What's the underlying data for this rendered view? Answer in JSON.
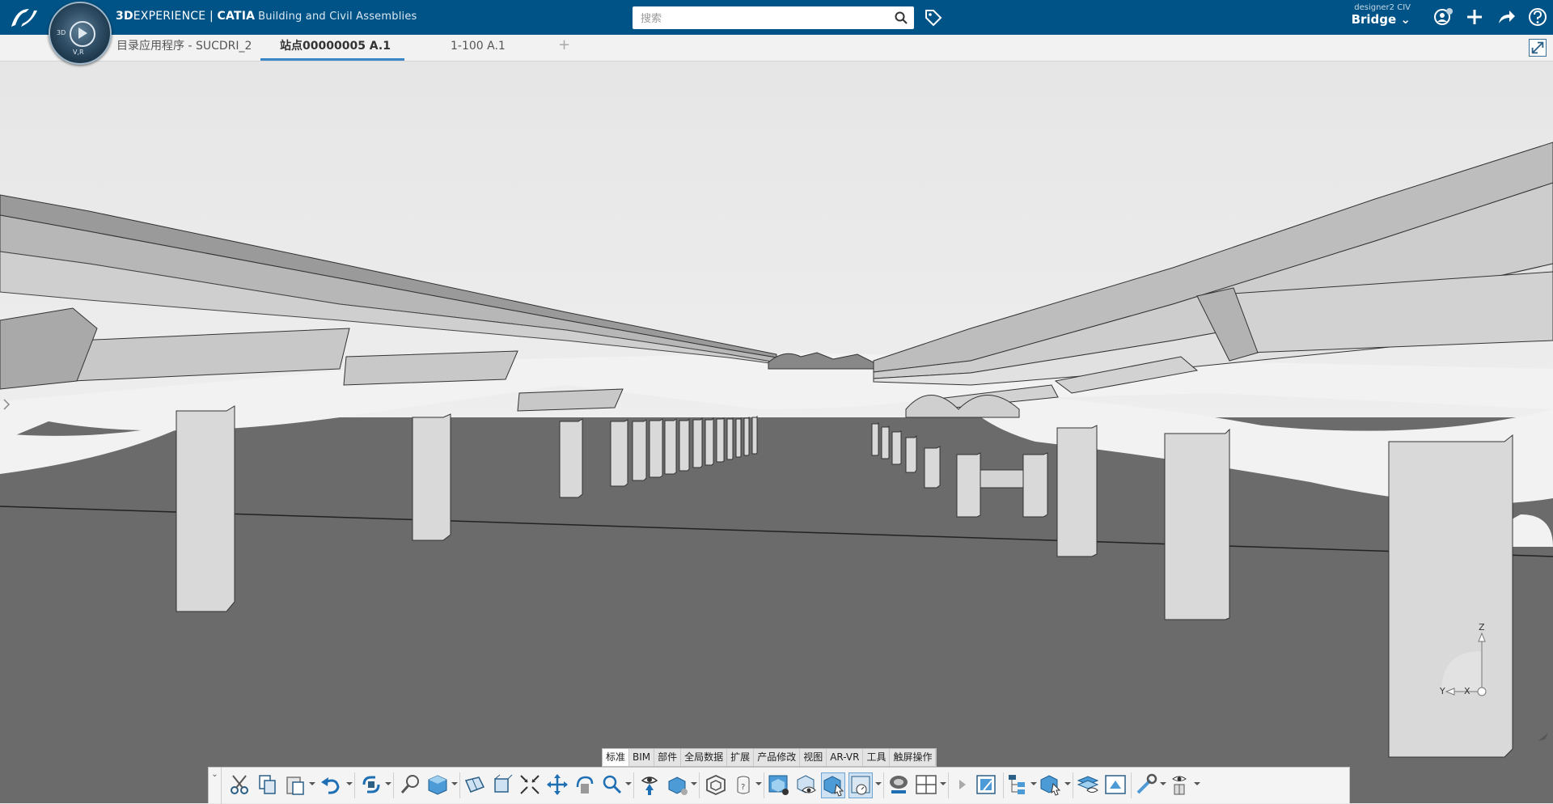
{
  "header": {
    "brand_3d": "3D",
    "brand_experience": "EXPERIENCE",
    "brand_separator": " | ",
    "brand_app": "CATIA",
    "brand_role": "Building and Civil Assemblies",
    "compass_label_top": "3D",
    "compass_label_bottom": "V,R",
    "search_placeholder": "搜索",
    "user_line1": "designer2 CIV",
    "user_line2": "Bridge ⌄",
    "icons": [
      "tag-icon",
      "user-icon",
      "add-icon",
      "share-icon",
      "help-icon"
    ]
  },
  "tabs": [
    {
      "label": "目录应用程序 - SUCDRI_2",
      "active": false
    },
    {
      "label": "站点00000005 A.1",
      "active": true
    },
    {
      "label": "1-100 A.1",
      "active": false
    }
  ],
  "tab_add": "+",
  "axis": {
    "z": "Z",
    "y": "Y",
    "x": "X"
  },
  "category_tabs": [
    {
      "label": "标准",
      "active": true
    },
    {
      "label": "BIM",
      "active": false
    },
    {
      "label": "部件",
      "active": false
    },
    {
      "label": "全局数据",
      "active": false
    },
    {
      "label": "扩展",
      "active": false
    },
    {
      "label": "产品修改",
      "active": false
    },
    {
      "label": "视图",
      "active": false
    },
    {
      "label": "AR-VR",
      "active": false
    },
    {
      "label": "工具",
      "active": false
    },
    {
      "label": "触屏操作",
      "active": false
    }
  ],
  "toolbar": {
    "tools": [
      "cut-icon",
      "copy-icon",
      "paste-icon",
      "undo-icon",
      "update-icon",
      "fly-icon",
      "view-cube-icon",
      "section-icon",
      "section-box-icon",
      "fit-all-icon",
      "pan-icon",
      "rotate-icon",
      "zoom-icon",
      "look-at-icon",
      "view-mode-icon",
      "hide-icon",
      "measure-icon",
      "render-icon",
      "visibility-icon",
      "select-mode-icon",
      "snapshot-icon",
      "lighting-icon",
      "layout-icon",
      "filter-icon",
      "tree-icon",
      "explode-icon",
      "layers-icon",
      "image-icon",
      "tools-icon",
      "settings-icon"
    ]
  },
  "colors": {
    "topbar": "#005386",
    "ground": "#6a6a6a",
    "sky": "#f0f0f0",
    "accent": "#3a87c8"
  }
}
